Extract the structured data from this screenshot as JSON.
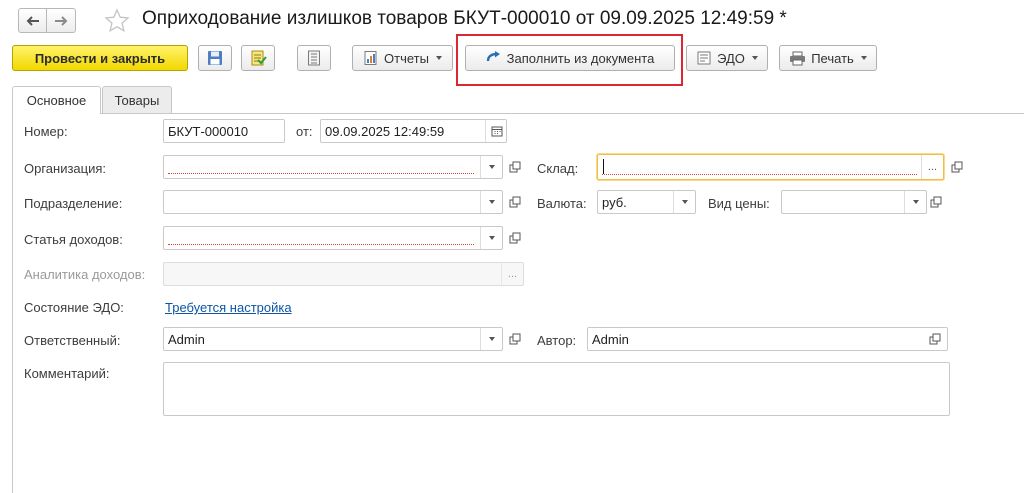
{
  "window": {
    "title": "Оприходование излишков товаров БКУТ-000010 от 09.09.2025 12:49:59 *"
  },
  "icons": {
    "back": "arrow-left-icon",
    "forward": "arrow-right-icon",
    "favorite": "star-icon",
    "save": "floppy-disk-icon",
    "post": "post-document-icon",
    "journal": "journal-list-icon",
    "reports": "reports-icon",
    "fill": "fill-arrow-icon",
    "edo": "edo-document-icon",
    "print": "printer-icon",
    "calendar": "calendar-icon",
    "open": "open-form-icon"
  },
  "colors": {
    "primary_button": "#f5dc18",
    "highlight_frame": "#d9282f",
    "link": "#0c55a8",
    "required_underline": "#e04040",
    "focus_border": "#f2bd44"
  },
  "toolbar": {
    "post_and_close": "Провести и закрыть",
    "reports": "Отчеты",
    "fill_from_document": "Заполнить из документа",
    "edo": "ЭДО",
    "print": "Печать",
    "select_dots": "..."
  },
  "tabs": [
    {
      "label": "Основное",
      "active": true
    },
    {
      "label": "Товары",
      "active": false
    }
  ],
  "form": {
    "number": {
      "label": "Номер:",
      "value": "БКУТ-000010"
    },
    "date": {
      "label": "от:",
      "value": "09.09.2025 12:49:59"
    },
    "organization": {
      "label": "Организация:",
      "value": ""
    },
    "warehouse": {
      "label": "Склад:",
      "value": ""
    },
    "department": {
      "label": "Подразделение:",
      "value": ""
    },
    "currency": {
      "label": "Валюта:",
      "value": "руб."
    },
    "price_type": {
      "label": "Вид цены:",
      "value": ""
    },
    "income_item": {
      "label": "Статья доходов:",
      "value": ""
    },
    "income_analytics": {
      "label": "Аналитика доходов:",
      "value": ""
    },
    "edo_state": {
      "label": "Состояние ЭДО:",
      "link": "Требуется настройка"
    },
    "responsible": {
      "label": "Ответственный:",
      "value": "Admin"
    },
    "author": {
      "label": "Автор:",
      "value": "Admin"
    },
    "comment": {
      "label": "Комментарий:",
      "value": ""
    }
  }
}
